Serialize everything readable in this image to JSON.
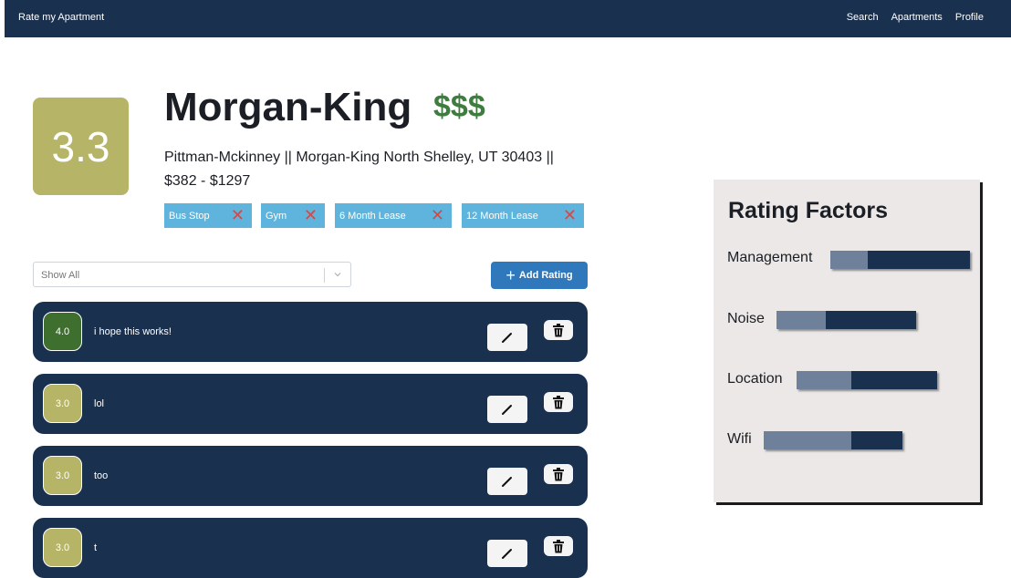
{
  "navbar": {
    "brand": "Rate my Apartment",
    "links": [
      "Search",
      "Apartments",
      "Profile"
    ]
  },
  "apartment": {
    "score": "3.3",
    "name": "Morgan-King",
    "price_level": "$$$",
    "address": "Pittman-Mckinney || Morgan-King North Shelley, UT 30403 || $382 - $1297",
    "tags": [
      "Bus Stop",
      "Gym",
      "6 Month Lease",
      "12 Month Lease"
    ]
  },
  "filter": {
    "selected": "Show All"
  },
  "add_rating_label": "Add Rating",
  "ratings": [
    {
      "score": "4.0",
      "comment": "i hope this works!",
      "color": "#3e6f2f"
    },
    {
      "score": "3.0",
      "comment": "lol",
      "color": "#b6b466"
    },
    {
      "score": "3.0",
      "comment": "too",
      "color": "#b6b466"
    },
    {
      "score": "3.0",
      "comment": "t",
      "color": "#b6b466"
    }
  ],
  "rating_factors": {
    "title": "Rating Factors",
    "factors": [
      {
        "label": "Management",
        "fraction": 0.27
      },
      {
        "label": "Noise",
        "fraction": 0.35
      },
      {
        "label": "Location",
        "fraction": 0.39
      },
      {
        "label": "Wifi",
        "fraction": 0.63
      }
    ]
  },
  "icons": {
    "edit": "pencil-icon",
    "delete": "trash-icon",
    "remove_tag": "close-icon",
    "dropdown": "chevron-down-icon",
    "add": "plus-icon"
  },
  "colors": {
    "navy": "#19304f",
    "score_yellow": "#b6b466",
    "score_green": "#3e6f2f",
    "price_green": "#3f7c3f",
    "tag_blue": "#5eb4dd",
    "tag_remove_red": "#d04a49",
    "button_blue": "#2f78bc"
  }
}
